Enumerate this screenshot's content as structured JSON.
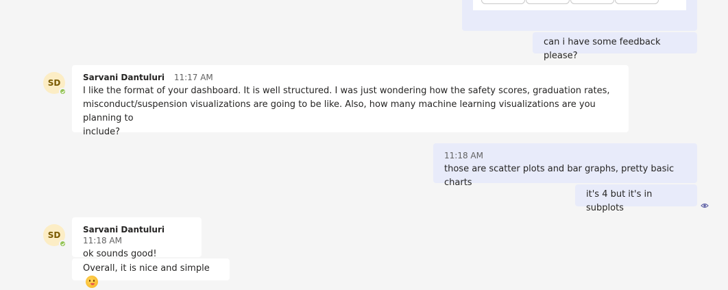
{
  "messages": {
    "m1": {
      "text": "can i have some feedback please?"
    },
    "m2": {
      "initials": "SD",
      "sender": "Sarvani Dantuluri",
      "time": "11:17 AM",
      "line1": "I like the format of your dashboard. It is well structured. I was just wondering how the safety scores, graduation rates,",
      "line2": "misconduct/suspension visualizations are going to be like. Also, how many machine learning visualizations are you planning to",
      "line3": "include?"
    },
    "m3": {
      "time": "11:18 AM",
      "text": "those are scatter plots and bar graphs, pretty basic charts"
    },
    "m4": {
      "text": "it's 4 but it's in subplots"
    },
    "m5": {
      "initials": "SD",
      "sender": "Sarvani Dantuluri",
      "time": "11:18 AM",
      "text": "ok sounds good!"
    },
    "m6": {
      "text": "Overall, it is nice and simple"
    }
  },
  "colors": {
    "background": "#f5f5f5",
    "my_bubble": "#e8ebfa",
    "other_bubble": "#ffffff",
    "avatar": "#fcedc5",
    "presence": "#92c353",
    "seen": "#6264a7"
  },
  "icons": {
    "presence": "available-check-icon",
    "seen": "seen-eye-icon",
    "emoji": "smiling-emoji-icon"
  }
}
